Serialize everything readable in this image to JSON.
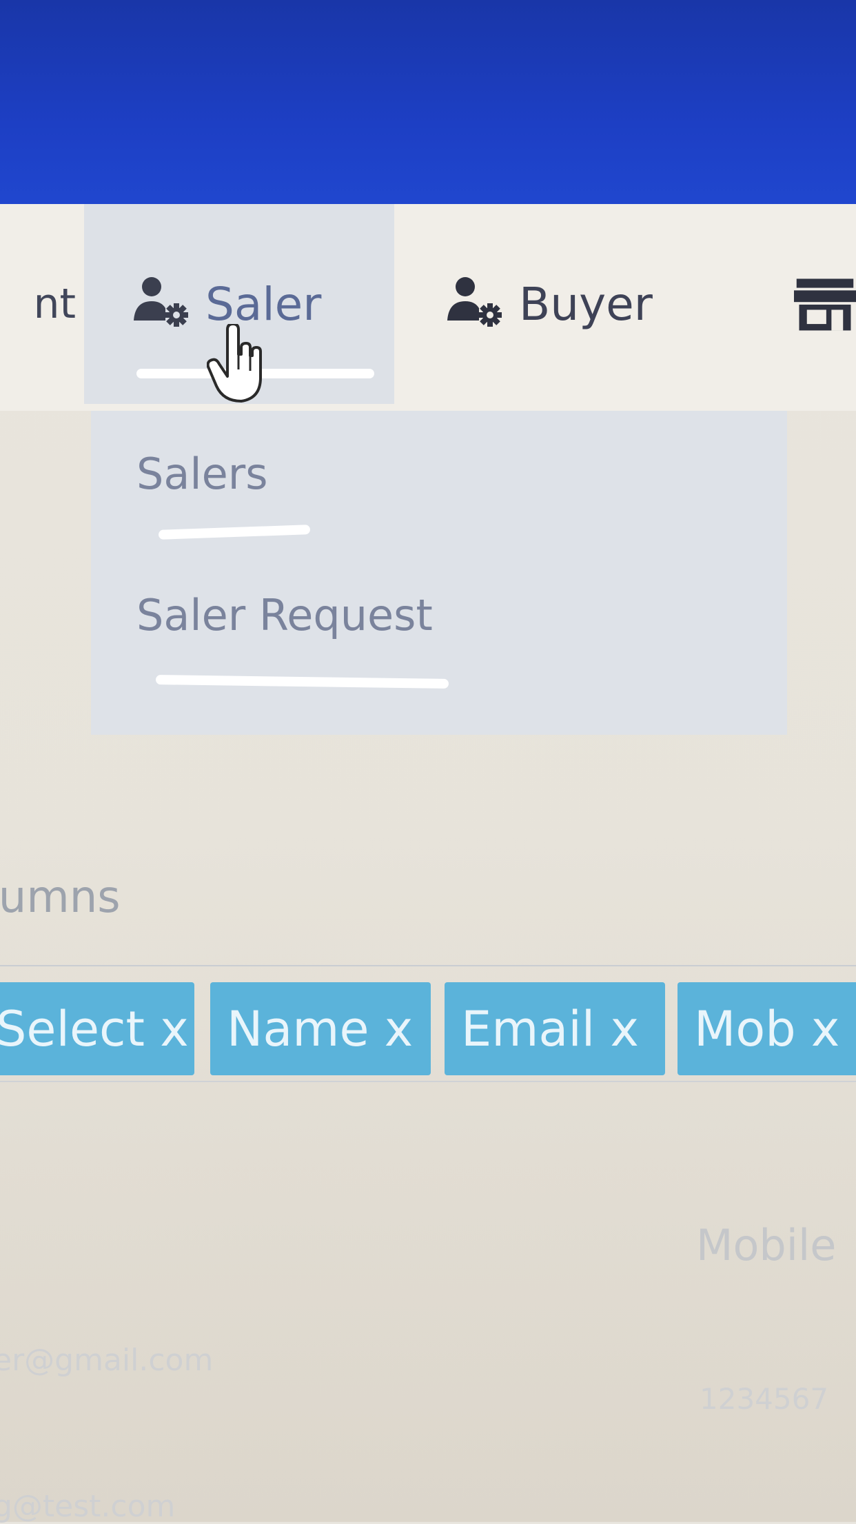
{
  "nav": {
    "partial_item": "nt",
    "saler": "Saler",
    "buyer": "Buyer"
  },
  "dropdown": {
    "items": [
      "Salers",
      "Saler Request"
    ]
  },
  "columns": {
    "label": "lumns",
    "tags": [
      "Select x",
      "Name x",
      "Email x",
      "Mob x"
    ]
  },
  "table": {
    "header_mobile": "Mobile",
    "row1_email": "er@gmail.com",
    "row1_mobile": "1234567",
    "row2_email": "g@test.com"
  },
  "icons": [
    "user-cog-icon",
    "store-icon",
    "hand-pointer-cursor-icon"
  ],
  "colors": {
    "header_blue": "#1d3fc4",
    "tag_blue": "#5bb3da",
    "menu_highlight": "#dde1e7"
  }
}
